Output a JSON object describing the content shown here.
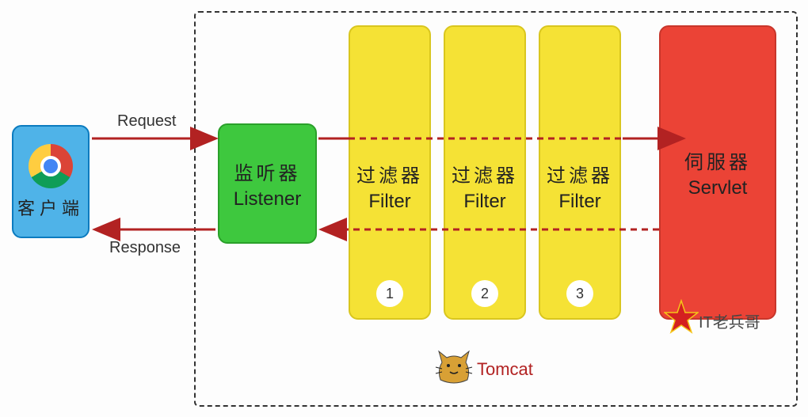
{
  "client": {
    "label": "客户端"
  },
  "listener": {
    "cn": "监听器",
    "en": "Listener"
  },
  "filters": [
    {
      "cn": "过滤器",
      "en": "Filter",
      "num": "1"
    },
    {
      "cn": "过滤器",
      "en": "Filter",
      "num": "2"
    },
    {
      "cn": "过滤器",
      "en": "Filter",
      "num": "3"
    }
  ],
  "servlet": {
    "cn": "伺服器",
    "en": "Servlet"
  },
  "arrows": {
    "request": "Request",
    "response": "Response"
  },
  "container": {
    "label": "Tomcat"
  },
  "watermark": {
    "text": "IT老兵哥"
  },
  "colors": {
    "client": "#4fb3e8",
    "listener": "#3ec83e",
    "filter": "#f5e235",
    "servlet": "#eb4336",
    "arrow": "#b22222"
  }
}
